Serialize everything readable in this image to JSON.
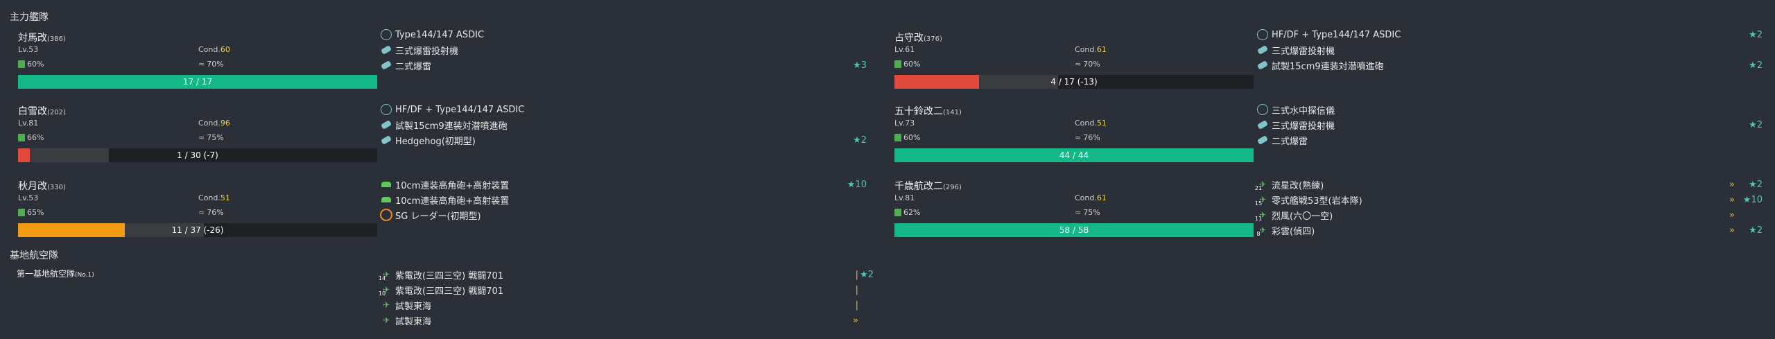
{
  "sections": {
    "main_fleet": "主力艦隊",
    "land_base": "基地航空隊"
  },
  "ships": [
    {
      "name": "対馬改",
      "id": "(386)",
      "lv": "Lv.53",
      "cond_label": "Cond.",
      "cond": "60",
      "fuel": "60%",
      "ammo": "70%",
      "hp": "17 / 17",
      "hp_fraction": 1.0,
      "hp_color": "#14b886",
      "equips": [
        {
          "icon": "sonar",
          "name": "Type144/147 ASDIC",
          "stars": ""
        },
        {
          "icon": "dc",
          "name": "三式爆雷投射機",
          "stars": ""
        },
        {
          "icon": "dc",
          "name": "二式爆雷",
          "stars": "★3"
        }
      ]
    },
    {
      "name": "占守改",
      "id": "(376)",
      "lv": "Lv.61",
      "cond_label": "Cond.",
      "cond": "61",
      "fuel": "60%",
      "ammo": "70%",
      "hp": "4 / 17 (-13)",
      "hp_fraction": 0.235,
      "hp_color": "#e04a3c",
      "equips": [
        {
          "icon": "sonar",
          "name": "HF/DF + Type144/147 ASDIC",
          "stars": "★2"
        },
        {
          "icon": "dc",
          "name": "三式爆雷投射機",
          "stars": ""
        },
        {
          "icon": "dc",
          "name": "試製15cm9連装対潜噴進砲",
          "stars": "★2"
        }
      ]
    },
    {
      "name": "白雪改",
      "id": "(202)",
      "lv": "Lv.81",
      "cond_label": "Cond.",
      "cond": "96",
      "fuel": "66%",
      "ammo": "75%",
      "hp": "1 / 30 (-7)",
      "hp_fraction": 0.033,
      "hp_color": "#e04a3c",
      "equips": [
        {
          "icon": "sonar",
          "name": "HF/DF + Type144/147 ASDIC",
          "stars": ""
        },
        {
          "icon": "dc",
          "name": "試製15cm9連装対潜噴進砲",
          "stars": ""
        },
        {
          "icon": "dc",
          "name": "Hedgehog(初期型)",
          "stars": "★2"
        }
      ]
    },
    {
      "name": "五十鈴改二",
      "id": "(141)",
      "lv": "Lv.73",
      "cond_label": "Cond.",
      "cond": "51",
      "fuel": "60%",
      "ammo": "76%",
      "hp": "44 / 44",
      "hp_fraction": 1.0,
      "hp_color": "#14b886",
      "equips": [
        {
          "icon": "sonar",
          "name": "三式水中探信儀",
          "stars": ""
        },
        {
          "icon": "dc",
          "name": "三式爆雷投射機",
          "stars": "★2"
        },
        {
          "icon": "dc",
          "name": "二式爆雷",
          "stars": ""
        }
      ]
    },
    {
      "name": "秋月改",
      "id": "(330)",
      "lv": "Lv.53",
      "cond_label": "Cond.",
      "cond": "51",
      "fuel": "65%",
      "ammo": "76%",
      "hp": "11 / 37 (-26)",
      "hp_fraction": 0.297,
      "hp_color": "#f39c12",
      "equips": [
        {
          "icon": "gun",
          "name": "10cm連装高角砲+高射装置",
          "stars": "★10"
        },
        {
          "icon": "gun",
          "name": "10cm連装高角砲+高射装置",
          "stars": ""
        },
        {
          "icon": "radar",
          "name": "SG レーダー(初期型)",
          "stars": ""
        }
      ]
    },
    {
      "name": "千歳航改二",
      "id": "(296)",
      "lv": "Lv.81",
      "cond_label": "Cond.",
      "cond": "61",
      "fuel": "62%",
      "ammo": "75%",
      "hp": "58 / 58",
      "hp_fraction": 1.0,
      "hp_color": "#14b886",
      "equips": [
        {
          "icon": "plane",
          "slot": "21",
          "name": "流星改(熟練)",
          "prof": "»",
          "stars": "★2"
        },
        {
          "icon": "plane",
          "slot": "15",
          "name": "零式艦戦53型(岩本隊)",
          "prof": "»",
          "stars": "★10"
        },
        {
          "icon": "plane",
          "slot": "11",
          "name": "烈風(六〇一空)",
          "prof": "»",
          "stars": ""
        },
        {
          "icon": "plane",
          "slot": "8",
          "name": "彩雲(偵四)",
          "prof": "»",
          "stars": "★2"
        }
      ]
    }
  ],
  "land_base": {
    "name": "第一基地航空隊",
    "num": "(No.1)",
    "equips": [
      {
        "icon": "plane",
        "slot": "14",
        "name": "紫電改(三四三空) 戦闘701",
        "prof": "|",
        "stars": "★2"
      },
      {
        "icon": "plane",
        "slot": "10",
        "name": "紫電改(三四三空) 戦闘701",
        "prof": "|",
        "stars": ""
      },
      {
        "icon": "plane",
        "slot": "",
        "name": "試製東海",
        "prof": "|",
        "stars": ""
      },
      {
        "icon": "plane",
        "slot": "",
        "name": "試製東海",
        "prof": "»",
        "stars": ""
      }
    ]
  },
  "colors": {
    "cond_normal": "#e8d44d",
    "cond_sparkle": "#f2d14a",
    "star": "#4cc9b0",
    "hp_full": "#14b886",
    "hp_heavy": "#e04a3c",
    "hp_medium": "#f39c12"
  }
}
